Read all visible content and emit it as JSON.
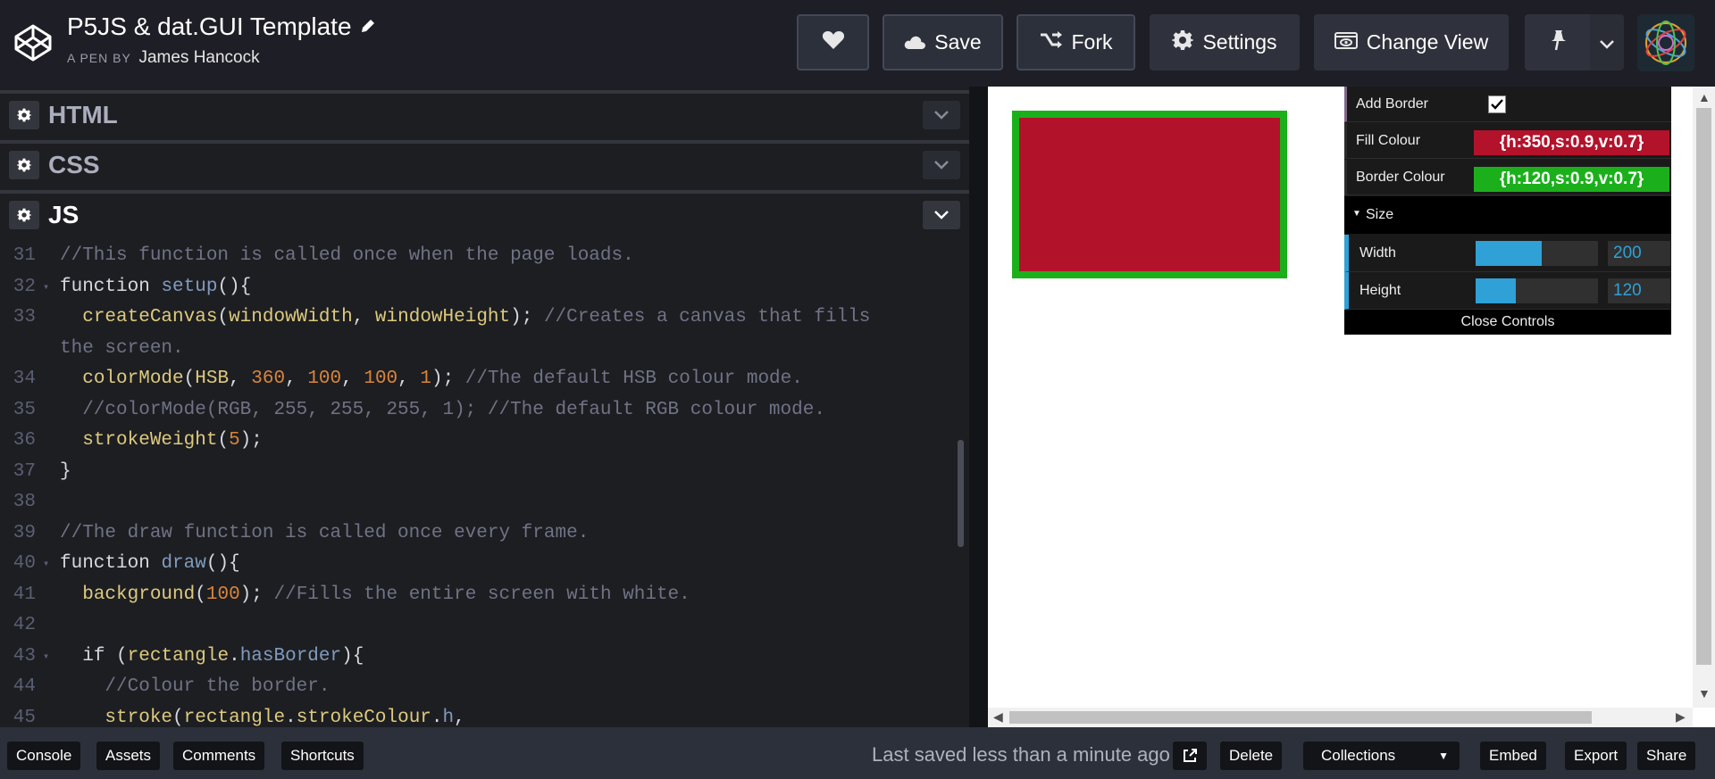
{
  "header": {
    "title": "P5JS & dat.GUI Template",
    "byline_prefix": "A PEN BY",
    "author": "James Hancock",
    "buttons": {
      "save": "Save",
      "fork": "Fork",
      "settings": "Settings",
      "change_view": "Change View"
    }
  },
  "panels": {
    "html": "HTML",
    "css": "CSS",
    "js": "JS"
  },
  "code_lines": [
    {
      "n": "31",
      "fold": "",
      "text": "//This function is called once when the page loads."
    },
    {
      "n": "32",
      "fold": "▾",
      "text": "function setup(){"
    },
    {
      "n": "33",
      "fold": "",
      "text": "  createCanvas(windowWidth, windowHeight); //Creates a canvas that fills"
    },
    {
      "n": "",
      "fold": "",
      "text": "the screen."
    },
    {
      "n": "34",
      "fold": "",
      "text": "  colorMode(HSB, 360, 100, 100, 1); //The default HSB colour mode."
    },
    {
      "n": "35",
      "fold": "",
      "text": "  //colorMode(RGB, 255, 255, 255, 1); //The default RGB colour mode."
    },
    {
      "n": "36",
      "fold": "",
      "text": "  strokeWeight(5);"
    },
    {
      "n": "37",
      "fold": "",
      "text": "}"
    },
    {
      "n": "38",
      "fold": "",
      "text": ""
    },
    {
      "n": "39",
      "fold": "",
      "text": "//The draw function is called once every frame."
    },
    {
      "n": "40",
      "fold": "▾",
      "text": "function draw(){"
    },
    {
      "n": "41",
      "fold": "",
      "text": "  background(100); //Fills the entire screen with white."
    },
    {
      "n": "42",
      "fold": "",
      "text": ""
    },
    {
      "n": "43",
      "fold": "▾",
      "text": "  if (rectangle.hasBorder){"
    },
    {
      "n": "44",
      "fold": "",
      "text": "    //Colour the border."
    },
    {
      "n": "45",
      "fold": "",
      "text": "    stroke(rectangle.strokeColour.h,"
    }
  ],
  "gui": {
    "add_border": "Add Border",
    "add_border_checked": true,
    "fill_colour_label": "Fill Colour",
    "fill_colour_value": "{h:350,s:0.9,v:0.7}",
    "fill_colour_hex": "#b3122b",
    "border_colour_label": "Border Colour",
    "border_colour_value": "{h:120,s:0.9,v:0.7}",
    "border_colour_hex": "#1bb01b",
    "size_folder": "Size",
    "width_label": "Width",
    "width_value": "200",
    "width_fraction": 0.54,
    "height_label": "Height",
    "height_value": "120",
    "height_fraction": 0.33,
    "close_controls": "Close Controls"
  },
  "footer": {
    "console": "Console",
    "assets": "Assets",
    "comments": "Comments",
    "shortcuts": "Shortcuts",
    "last_saved": "Last saved less than a minute ago",
    "delete": "Delete",
    "collections": "Collections",
    "embed": "Embed",
    "export": "Export",
    "share": "Share"
  },
  "colors": {
    "accent": "#2fa1d6",
    "fill": "#b3122b",
    "border": "#1bb01b"
  }
}
